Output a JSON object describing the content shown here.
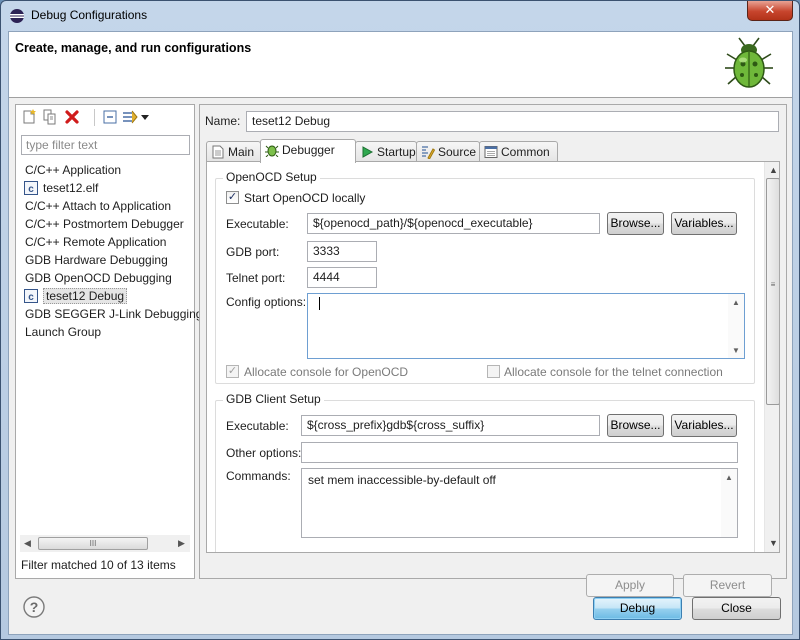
{
  "window": {
    "title": "Debug Configurations",
    "close_glyph": "✕"
  },
  "header": {
    "title": "Create, manage, and run configurations",
    "icon": "bug-icon"
  },
  "sidebar": {
    "filter_placeholder": "type filter text",
    "items": [
      {
        "label": "C/C++ Application",
        "icon": null
      },
      {
        "label": "teset12.elf",
        "icon": "c-file-icon",
        "child": true
      },
      {
        "label": "C/C++ Attach to Application"
      },
      {
        "label": "C/C++ Postmortem Debugger"
      },
      {
        "label": "C/C++ Remote Application"
      },
      {
        "label": "GDB Hardware Debugging"
      },
      {
        "label": "GDB OpenOCD Debugging"
      },
      {
        "label": "teset12 Debug",
        "icon": "c-file-icon",
        "child": true,
        "selected": true
      },
      {
        "label": "GDB SEGGER J-Link Debugging"
      },
      {
        "label": "Launch Group"
      }
    ],
    "scroll_thumb_glyph": "III",
    "status": "Filter matched 10 of 13 items"
  },
  "main": {
    "name_label": "Name:",
    "name_value": "teset12 Debug",
    "tabs": [
      {
        "label": "Main",
        "icon": "main-tab-icon"
      },
      {
        "label": "Debugger",
        "icon": "debugger-tab-icon",
        "active": true
      },
      {
        "label": "Startup",
        "icon": "startup-tab-icon"
      },
      {
        "label": "Source",
        "icon": "source-tab-icon"
      },
      {
        "label": "Common",
        "icon": "common-tab-icon"
      }
    ],
    "openocd": {
      "group_title": "OpenOCD Setup",
      "start_locally_label": "Start OpenOCD locally",
      "start_locally_checked": true,
      "executable_label": "Executable:",
      "executable_value": "${openocd_path}/${openocd_executable}",
      "browse": "Browse...",
      "variables": "Variables...",
      "gdb_port_label": "GDB port:",
      "gdb_port_value": "3333",
      "telnet_port_label": "Telnet port:",
      "telnet_port_value": "4444",
      "config_label": "Config options:",
      "config_value": "",
      "allocate_console_label": "Allocate console for OpenOCD",
      "allocate_console_checked": true,
      "allocate_telnet_label": "Allocate console for the telnet connection",
      "allocate_telnet_checked": false
    },
    "gdb_client": {
      "group_title": "GDB Client Setup",
      "executable_label": "Executable:",
      "executable_value": "${cross_prefix}gdb${cross_suffix}",
      "browse": "Browse...",
      "variables": "Variables...",
      "other_options_label": "Other options:",
      "other_options_value": "",
      "commands_label": "Commands:",
      "commands_value": "set mem inaccessible-by-default off"
    },
    "apply": "Apply",
    "revert": "Revert"
  },
  "footer": {
    "debug": "Debug",
    "close": "Close",
    "help_glyph": "?"
  },
  "colors": {
    "accent": "#3c7fb1",
    "close_red": "#c7452d",
    "checkbox_tick": "#1c2f62"
  }
}
